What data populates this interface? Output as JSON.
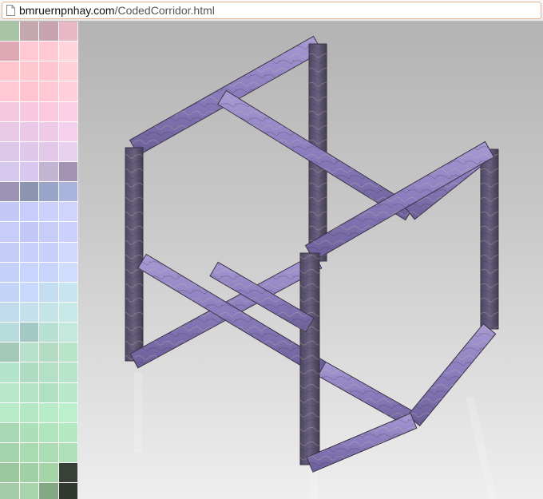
{
  "browser": {
    "url_domain": "bmruernpnhay.com",
    "url_path": "/CodedCorridor.html"
  },
  "palette": {
    "colors": [
      "#a8c4a4",
      "#c4a8ae",
      "#c8a4b0",
      "#e8b8c4",
      "#e0a8b4",
      "#ffc8d4",
      "#ffc8d4",
      "#ffd4dc",
      "#ffc4cc",
      "#ffc8d0",
      "#ffc4d0",
      "#ffd0d8",
      "#ffc8d4",
      "#ffc4d0",
      "#ffc8d4",
      "#ffd0dc",
      "#f4c8dc",
      "#f8c8e0",
      "#fcc8e0",
      "#fcd0e4",
      "#e8c8e4",
      "#ecc8e8",
      "#f0c8e8",
      "#f4d0ec",
      "#dcc8e8",
      "#e0c8ec",
      "#e4c8ec",
      "#e8d0f0",
      "#d4c8ec",
      "#d8c8f0",
      "#c4b4d4",
      "#a494b4",
      "#9c94b4",
      "#8c94b0",
      "#98a4c8",
      "#a8b4dc",
      "#c4c8f8",
      "#c8ccfc",
      "#ccd0fc",
      "#d0d4fc",
      "#c8ccf8",
      "#c4c8f8",
      "#c8ccf8",
      "#ccd0fc",
      "#c4ccf8",
      "#c8d0fc",
      "#c8d0fc",
      "#d0d8fc",
      "#c4d0f8",
      "#c8d4fc",
      "#c8d4fc",
      "#d0dcfc",
      "#c4d4f8",
      "#c8d8fc",
      "#c4dcf0",
      "#c8e4f0",
      "#c0dcec",
      "#c4e0ec",
      "#c4e4e8",
      "#c8e8e8",
      "#b8dcdc",
      "#a4c8c4",
      "#b8e0d4",
      "#c4e8dc",
      "#a4c8b8",
      "#b8e0cc",
      "#b4dcc4",
      "#b8e4c8",
      "#b4e4cc",
      "#b0dcc4",
      "#b4e0c8",
      "#b8e4cc",
      "#b8e8c8",
      "#b4e4c4",
      "#b0e0c0",
      "#b8e8c8",
      "#b8ecc8",
      "#b4e8c4",
      "#b8ecc8",
      "#bcf0cc",
      "#a8d8b4",
      "#ace0b8",
      "#b0e4bc",
      "#b4e8c0",
      "#a4d4ac",
      "#a8dcb0",
      "#acdcb4",
      "#b0e0b8",
      "#9cc8a0",
      "#a0d0a4",
      "#a4d4a8",
      "#384038",
      "#a4cca8",
      "#a8d4ac",
      "#84a884",
      "#303830"
    ]
  },
  "scene": {
    "object": "impossible-cube",
    "frame_color": "#8878b8",
    "frame_shadow_color": "#4a4458"
  }
}
